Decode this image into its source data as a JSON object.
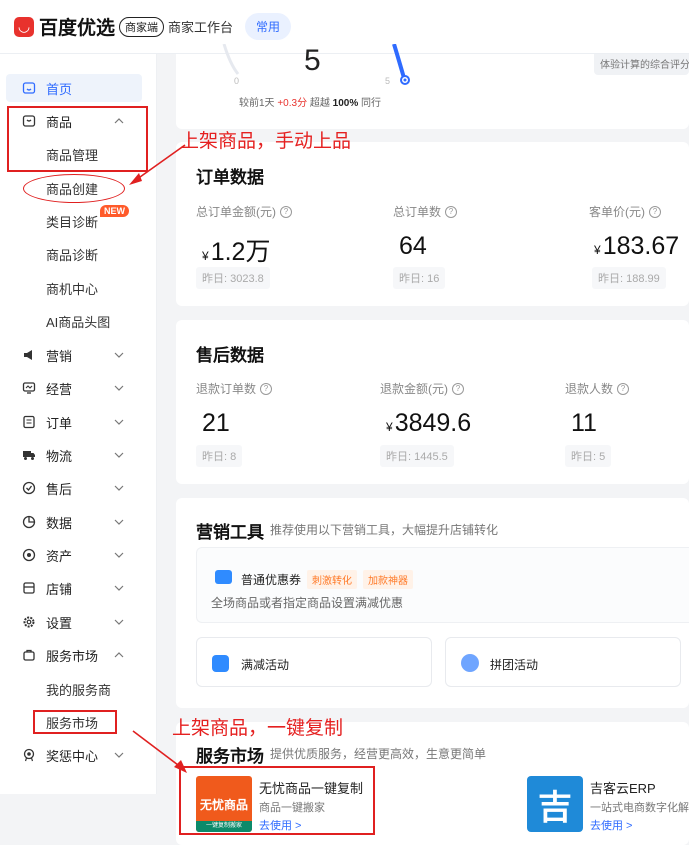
{
  "header": {
    "logo_text": "百度优选",
    "logo_tag": "商家端",
    "subtitle": "商家工作台",
    "mode_tag": "常用"
  },
  "sidebar": {
    "items": [
      {
        "label": "首页",
        "icon": "home-icon",
        "active": true
      },
      {
        "label": "商品",
        "icon": "goods-icon",
        "expanded": true
      },
      {
        "label": "商品管理",
        "sub": true
      },
      {
        "label": "商品创建",
        "sub": true
      },
      {
        "label": "类目诊断",
        "sub": true,
        "badge": "NEW"
      },
      {
        "label": "商品诊断",
        "sub": true
      },
      {
        "label": "商机中心",
        "sub": true
      },
      {
        "label": "AI商品头图",
        "sub": true
      },
      {
        "label": "营销",
        "icon": "megaphone-icon"
      },
      {
        "label": "经营",
        "icon": "monitor-icon"
      },
      {
        "label": "订单",
        "icon": "order-icon"
      },
      {
        "label": "物流",
        "icon": "truck-icon"
      },
      {
        "label": "售后",
        "icon": "after-sale-icon"
      },
      {
        "label": "数据",
        "icon": "pie-chart-icon"
      },
      {
        "label": "资产",
        "icon": "asset-icon"
      },
      {
        "label": "店铺",
        "icon": "store-icon"
      },
      {
        "label": "设置",
        "icon": "gear-icon"
      },
      {
        "label": "服务市场",
        "icon": "service-icon",
        "expanded": true
      },
      {
        "label": "我的服务商",
        "sub": true
      },
      {
        "label": "服务市场",
        "sub": true
      },
      {
        "label": "奖惩中心",
        "icon": "reward-icon"
      }
    ]
  },
  "annotations": {
    "top_note": "上架商品，手动上品",
    "bottom_note": "上架商品，一键复制",
    "color": "#e02020"
  },
  "score_card": {
    "score": "5",
    "min": "0",
    "max": "5",
    "compare_prefix": "较前1天",
    "delta": "+0.3分",
    "beat_label": "超越",
    "beat_value": "100%",
    "beat_suffix": "同行",
    "right_note": "体验计算的综合评分"
  },
  "orders": {
    "title": "订单数据",
    "metrics": [
      {
        "label": "总订单金额(元)",
        "currency": "¥",
        "value": "1.2万",
        "yesterday": "昨日: 3023.8"
      },
      {
        "label": "总订单数",
        "currency": "",
        "value": "64",
        "yesterday": "昨日: 16"
      },
      {
        "label": "客单价(元)",
        "currency": "¥",
        "value": "183.67",
        "yesterday": "昨日: 188.99"
      }
    ]
  },
  "after_sales": {
    "title": "售后数据",
    "metrics": [
      {
        "label": "退款订单数",
        "currency": "",
        "value": "21",
        "yesterday": "昨日: 8"
      },
      {
        "label": "退款金额(元)",
        "currency": "¥",
        "value": "3849.6",
        "yesterday": "昨日: 1445.5"
      },
      {
        "label": "退款人数",
        "currency": "",
        "value": "11",
        "yesterday": "昨日: 5"
      }
    ]
  },
  "marketing": {
    "title": "营销工具",
    "subtitle": "推荐使用以下营销工具，大幅提升店铺转化",
    "coupon": {
      "name": "普通优惠券",
      "tag1": "刺激转化",
      "tag2": "加款神器",
      "desc": "全场商品或者指定商品设置满减优惠"
    },
    "tools": [
      "满减活动",
      "拼团活动"
    ]
  },
  "service_market": {
    "title": "服务市场",
    "subtitle": "提供优质服务，经营更高效，生意更简单",
    "apps": [
      {
        "name": "无忧商品一键复制",
        "desc": "商品一键搬家",
        "link": "去使用 >",
        "logo_text": "无忧商品",
        "logo_sub": "一键复制搬家",
        "logo_color": "#f05a1c"
      },
      {
        "name": "吉客云ERP",
        "desc": "一站式电商数字化解",
        "link": "去使用 >",
        "logo_text": "吉",
        "logo_color": "#1f8ad8"
      }
    ]
  }
}
